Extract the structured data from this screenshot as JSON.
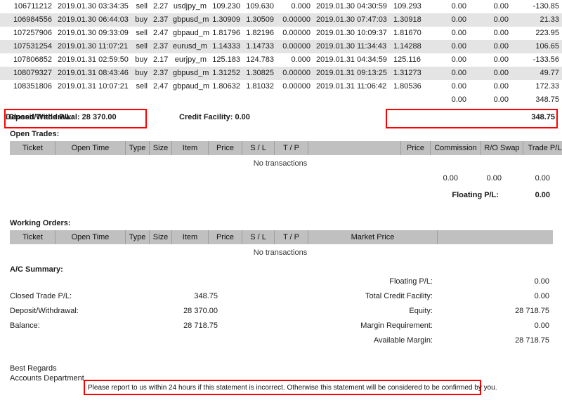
{
  "closed_trades": {
    "rows": [
      {
        "ticket": "106711212",
        "open_time": "2019.01.30 03:34:35",
        "type": "sell",
        "size": "2.27",
        "item": "usdjpy_m",
        "price": "109.230",
        "sl": "109.630",
        "tp": "0.000",
        "close_time": "2019.01.30 04:30:59",
        "close_price": "109.293",
        "commission": "0.00",
        "swap": "0.00",
        "profit": "-130.85"
      },
      {
        "ticket": "106984556",
        "open_time": "2019.01.30 06:44:03",
        "type": "buy",
        "size": "2.37",
        "item": "gbpusd_m",
        "price": "1.30909",
        "sl": "1.30509",
        "tp": "0.00000",
        "close_time": "2019.01.30 07:47:03",
        "close_price": "1.30918",
        "commission": "0.00",
        "swap": "0.00",
        "profit": "21.33"
      },
      {
        "ticket": "107257906",
        "open_time": "2019.01.30 09:33:09",
        "type": "sell",
        "size": "2.47",
        "item": "gbpaud_m",
        "price": "1.81796",
        "sl": "1.82196",
        "tp": "0.00000",
        "close_time": "2019.01.30 10:09:37",
        "close_price": "1.81670",
        "commission": "0.00",
        "swap": "0.00",
        "profit": "223.95"
      },
      {
        "ticket": "107531254",
        "open_time": "2019.01.30 11:07:21",
        "type": "sell",
        "size": "2.37",
        "item": "eurusd_m",
        "price": "1.14333",
        "sl": "1.14733",
        "tp": "0.00000",
        "close_time": "2019.01.30 11:34:43",
        "close_price": "1.14288",
        "commission": "0.00",
        "swap": "0.00",
        "profit": "106.65"
      },
      {
        "ticket": "107806852",
        "open_time": "2019.01.31 02:59:50",
        "type": "buy",
        "size": "2.17",
        "item": "eurjpy_m",
        "price": "125.183",
        "sl": "124.783",
        "tp": "0.000",
        "close_time": "2019.01.31 04:34:59",
        "close_price": "125.116",
        "commission": "0.00",
        "swap": "0.00",
        "profit": "-133.56"
      },
      {
        "ticket": "108079327",
        "open_time": "2019.01.31 08:43:46",
        "type": "buy",
        "size": "2.37",
        "item": "gbpusd_m",
        "price": "1.31252",
        "sl": "1.30825",
        "tp": "0.00000",
        "close_time": "2019.01.31 09:13:25",
        "close_price": "1.31273",
        "commission": "0.00",
        "swap": "0.00",
        "profit": "49.77"
      },
      {
        "ticket": "108351806",
        "open_time": "2019.01.31 10:07:21",
        "type": "sell",
        "size": "2.47",
        "item": "gbpaud_m",
        "price": "1.80632",
        "sl": "1.81032",
        "tp": "0.00000",
        "close_time": "2019.01.31 11:06:42",
        "close_price": "1.80536",
        "commission": "0.00",
        "swap": "0.00",
        "profit": "172.33"
      }
    ],
    "totals": {
      "commission": "0.00",
      "swap": "0.00",
      "profit": "348.75"
    }
  },
  "deposit_strip": {
    "deposit_withdrawal": "Deposit/Withdrawal: 28 370.00",
    "credit_facility": "Credit Facility: 0.00",
    "closed_trade_pl_label": "Closed Trade P/L:",
    "closed_trade_pl_value": "348.75",
    "highlight_color": "#ff0000"
  },
  "open_trades": {
    "title": "Open Trades:",
    "headers": [
      "Ticket",
      "Open Time",
      "Type",
      "Size",
      "Item",
      "Price",
      "S / L",
      "T / P",
      "",
      "Price",
      "Commission",
      "R/O Swap",
      "Trade P/L"
    ],
    "empty_text": "No transactions",
    "totals": {
      "commission": "0.00",
      "swap": "0.00",
      "profit": "0.00"
    },
    "floating_label": "Floating P/L:",
    "floating_value": "0.00"
  },
  "working_orders": {
    "title": "Working Orders:",
    "headers": [
      "Ticket",
      "Open Time",
      "Type",
      "Size",
      "Item",
      "Price",
      "S / L",
      "T / P",
      "Market Price",
      ""
    ],
    "empty_text": "No transactions"
  },
  "ac_summary": {
    "title": "A/C Summary:",
    "left": [
      {
        "label": "Closed Trade P/L:",
        "value": "348.75"
      },
      {
        "label": "Deposit/Withdrawal:",
        "value": "28 370.00"
      },
      {
        "label": "Balance:",
        "value": "28 718.75"
      }
    ],
    "right": [
      {
        "label": "Floating P/L:",
        "value": "0.00"
      },
      {
        "label": "Total Credit Facility:",
        "value": "0.00"
      },
      {
        "label": "Equity:",
        "value": "28 718.75"
      },
      {
        "label": "Margin Requirement:",
        "value": "0.00"
      },
      {
        "label": "Available Margin:",
        "value": "28 718.75"
      }
    ]
  },
  "footer": {
    "regards_line1": "Best Regards",
    "regards_line2": "Accounts Department",
    "notice": "Please report to us within 24 hours if this statement is incorrect. Otherwise this statement will be considered to be confirmed by you."
  }
}
